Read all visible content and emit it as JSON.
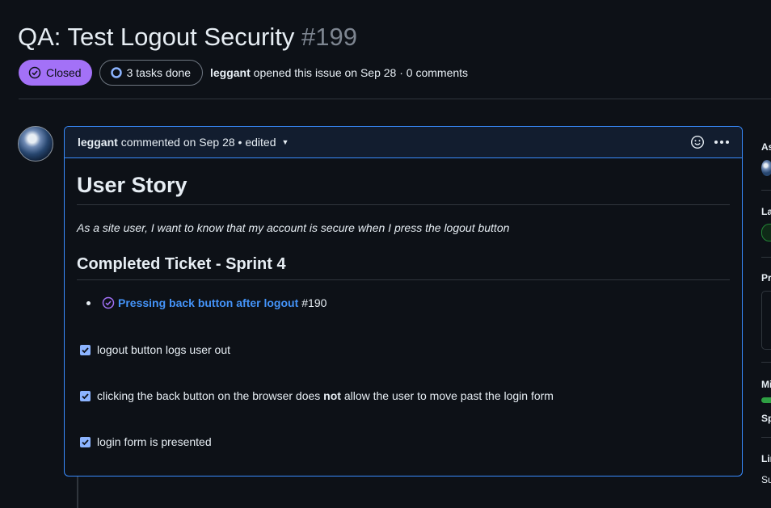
{
  "issue": {
    "title": "QA: Test Logout Security",
    "number": "#199",
    "status": "Closed",
    "tasks_badge": "3 tasks done",
    "author": "leggant",
    "opened_text": "opened this issue on Sep 28 · 0 comments"
  },
  "comment": {
    "author": "leggant",
    "meta": "commented on Sep 28 • edited",
    "heading": "User Story",
    "story": "As a site user, I want to know that my account is secure when I press the logout button",
    "section_heading": "Completed Ticket - Sprint 4",
    "ticket": {
      "title": "Pressing back button after logout",
      "number": "#190"
    },
    "tasks": [
      {
        "label": "logout button logs user out",
        "checked": true
      },
      {
        "before": "clicking the back button on the browser does ",
        "bold": "not",
        "after": " allow the user to move past the login form",
        "checked": true
      },
      {
        "label": "login form is presented",
        "checked": true
      }
    ]
  },
  "sidebar": {
    "labels": [
      "As",
      "La",
      "Pr",
      "Mi",
      "Sp",
      "Lin",
      "Su"
    ]
  },
  "colors": {
    "background": "#0d1117",
    "closed_badge": "#a371f7",
    "link": "#4493f8",
    "comment_border": "#388bfd",
    "comment_header": "#121d2f"
  }
}
